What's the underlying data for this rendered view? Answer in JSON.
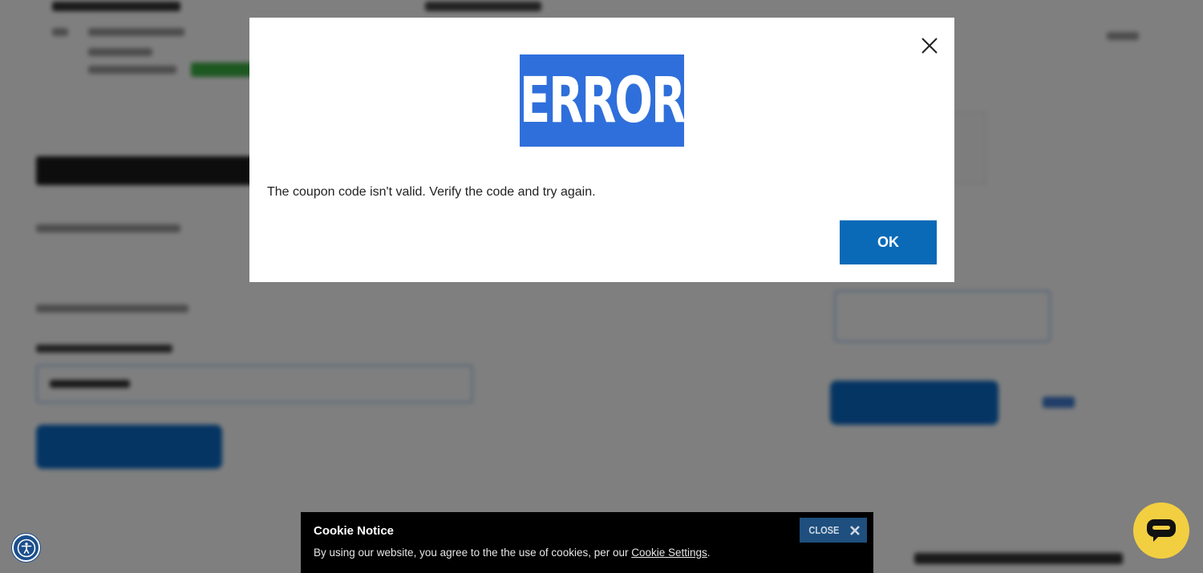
{
  "modal": {
    "heading": "ERROR",
    "message": "The coupon code isn't valid. Verify the code and try again.",
    "ok_label": "OK",
    "close_icon": "close-icon"
  },
  "cookie_notice": {
    "title": "Cookie Notice",
    "text_prefix": "By using our website, you agree to the the use of cookies, per our ",
    "link_label": "Cookie Settings",
    "text_suffix": ".",
    "close_label": "CLOSE",
    "close_icon": "close-x-icon"
  },
  "floating": {
    "accessibility_icon": "accessibility-icon",
    "chat_icon": "chat-icon"
  },
  "colors": {
    "error_banner": "#2f6fdb",
    "ok_button": "#0a6ab8",
    "cookie_bg": "#000000",
    "cookie_close_bg": "#1e4f7e",
    "chat_button": "#f2cf41",
    "overlay": "rgba(0,0,0,0.5)"
  }
}
